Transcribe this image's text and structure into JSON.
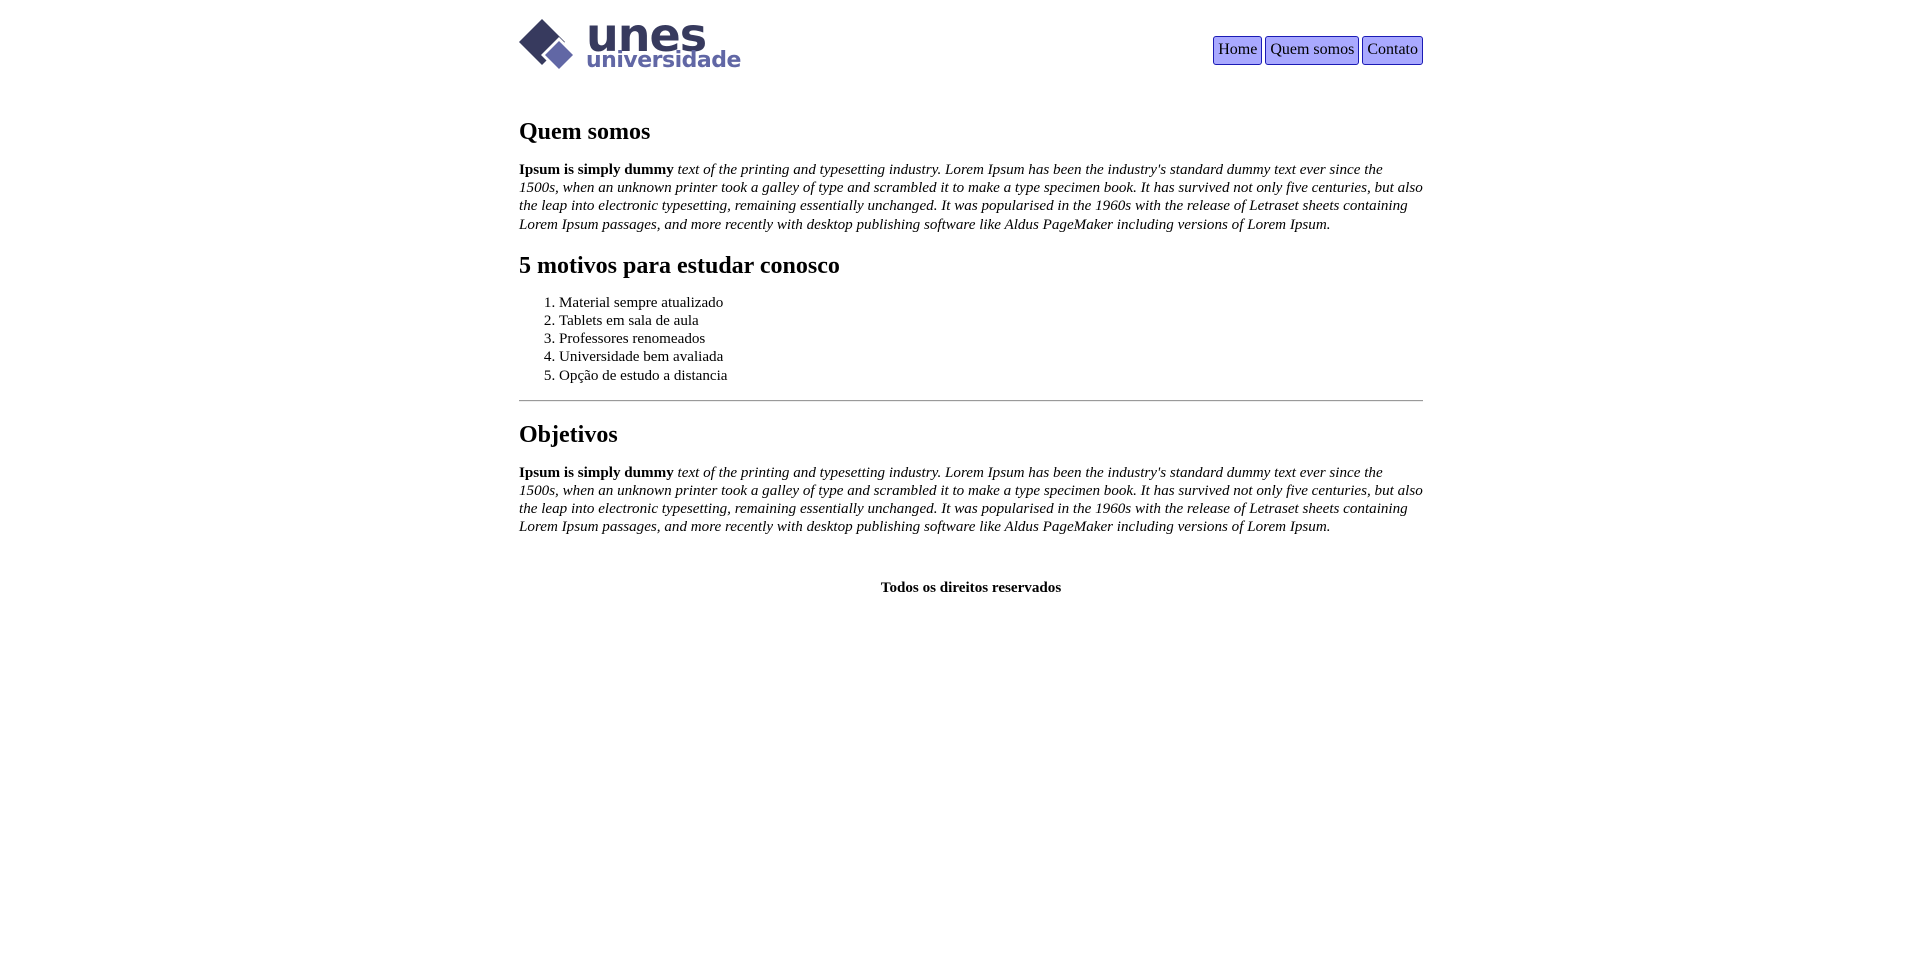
{
  "brand": {
    "logo_word": "unes",
    "logo_sub": "universidade",
    "primary_color": "#373a5e",
    "secondary_color": "#6167a5"
  },
  "nav": {
    "items": [
      {
        "label": "Home"
      },
      {
        "label": "Quem somos"
      },
      {
        "label": "Contato"
      }
    ],
    "button_color": "#a9a9ff",
    "button_border": "#1b1bb5"
  },
  "about": {
    "title": "Quem somos",
    "lead": "Ipsum is simply dummy",
    "body": "text of the printing and typesetting industry. Lorem Ipsum has been the industry's standard dummy text ever since the 1500s, when an unknown printer took a galley of type and scrambled it to make a type specimen book. It has survived not only five centuries, but also the leap into electronic typesetting, remaining essentially unchanged. It was popularised in the 1960s with the release of Letraset sheets containing Lorem Ipsum passages, and more recently with desktop publishing software like Aldus PageMaker including versions of Lorem Ipsum."
  },
  "reasons": {
    "title": "5 motivos para estudar conosco",
    "items": [
      "Material sempre atualizado",
      "Tablets em sala de aula",
      "Professores renomeados",
      "Universidade bem avaliada",
      "Opção de estudo a distancia"
    ]
  },
  "objectives": {
    "title": "Objetivos",
    "lead": "Ipsum is simply dummy",
    "body": "text of the printing and typesetting industry. Lorem Ipsum has been the industry's standard dummy text ever since the 1500s, when an unknown printer took a galley of type and scrambled it to make a type specimen book. It has survived not only five centuries, but also the leap into electronic typesetting, remaining essentially unchanged. It was popularised in the 1960s with the release of Letraset sheets containing Lorem Ipsum passages, and more recently with desktop publishing software like Aldus PageMaker including versions of Lorem Ipsum."
  },
  "footer": {
    "text": "Todos os direitos reservados"
  }
}
